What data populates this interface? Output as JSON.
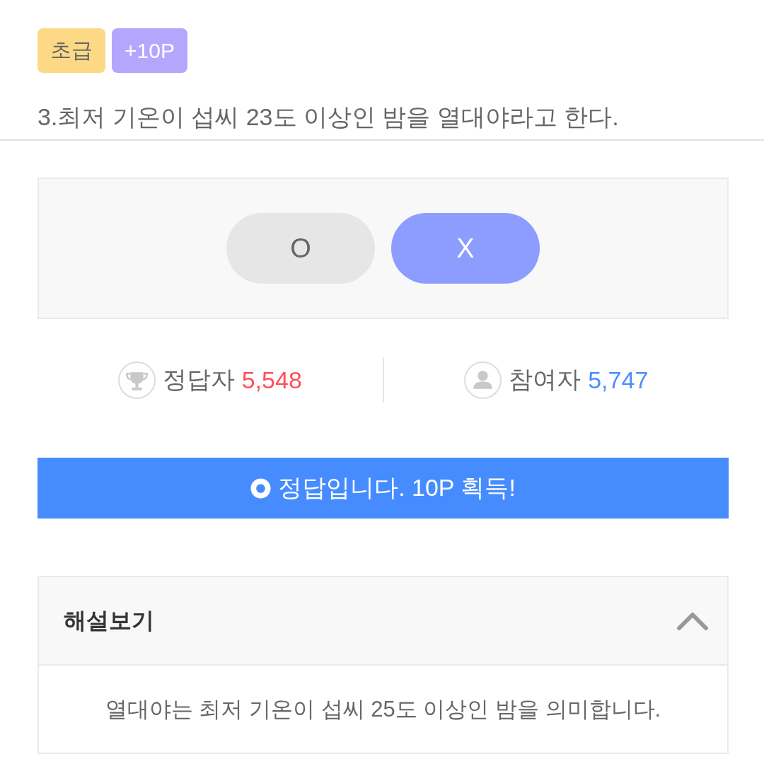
{
  "badges": [
    {
      "kind": "level",
      "label": "초급"
    },
    {
      "kind": "points",
      "label": "+10P"
    }
  ],
  "question": "3.최저 기온이 섭씨 23도 이상인 밤을 열대야라고 한다.",
  "options": [
    {
      "label": "O",
      "selected": false
    },
    {
      "label": "X",
      "selected": true
    }
  ],
  "stats": [
    {
      "kind": "correct",
      "label": "정답자",
      "count": "5,548",
      "color": "#ff4d5a"
    },
    {
      "kind": "participants",
      "label": "참여자",
      "count": "5,747",
      "color": "#4a8cff"
    }
  ],
  "result": {
    "kind": "correct",
    "message": "정답입니다. 10P 획득!"
  },
  "explanation": {
    "title": "해설보기",
    "expanded": true,
    "text": "열대야는 최저 기온이 섭씨 25도 이상인 밤을 의미합니다."
  }
}
